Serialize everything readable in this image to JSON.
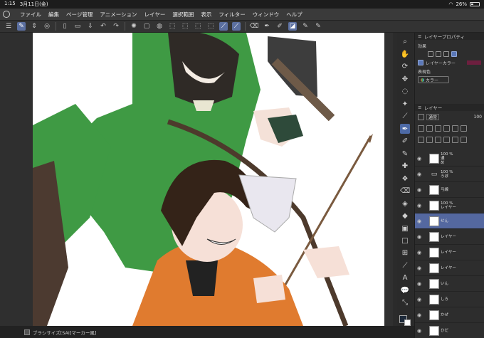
{
  "status_bar": {
    "time": "1:15",
    "date": "3月11日(金)",
    "battery": "26%",
    "battery_level": 0.26
  },
  "menu": {
    "items": [
      "ファイル",
      "編集",
      "ページ管理",
      "アニメーション",
      "レイヤー",
      "選択範囲",
      "表示",
      "フィルター",
      "ウィンドウ",
      "ヘルプ"
    ]
  },
  "property_panel": {
    "title": "レイヤープロパティ",
    "effect_label": "効果",
    "layer_color_label": "レイヤーカラー",
    "layer_color": "#6d1f3f",
    "expression_color_label": "表現色",
    "expression_color_value": "カラー"
  },
  "layer_panel": {
    "title": "レイヤー",
    "blend_mode": "通常",
    "opacity": "100",
    "layers": [
      {
        "opacity": "100 %",
        "name": "め",
        "prefix": "通",
        "type": "raster",
        "selected": false
      },
      {
        "opacity": "100 %",
        "name": "ろぽ",
        "prefix": "",
        "type": "folder",
        "selected": false
      },
      {
        "opacity": "",
        "name": "弓線",
        "prefix": "",
        "type": "raster",
        "selected": false
      },
      {
        "opacity": "100 %",
        "name": "レイヤー",
        "prefix": "",
        "type": "raster",
        "selected": false
      },
      {
        "opacity": "",
        "name": "せん",
        "prefix": "",
        "type": "raster",
        "selected": true
      },
      {
        "opacity": "",
        "name": "レイヤー",
        "prefix": "",
        "type": "raster",
        "selected": false
      },
      {
        "opacity": "",
        "name": "レイヤー",
        "prefix": "",
        "type": "raster",
        "selected": false
      },
      {
        "opacity": "",
        "name": "レイヤー",
        "prefix": "",
        "type": "raster",
        "selected": false
      },
      {
        "opacity": "",
        "name": "いん",
        "prefix": "",
        "type": "raster",
        "selected": false
      },
      {
        "opacity": "",
        "name": "しろ",
        "prefix": "",
        "type": "raster",
        "selected": false
      },
      {
        "opacity": "",
        "name": "かぜ",
        "prefix": "",
        "type": "raster",
        "selected": false
      },
      {
        "opacity": "",
        "name": "ひだ",
        "prefix": "",
        "type": "raster",
        "selected": false
      }
    ]
  },
  "bottom_bar": {
    "brush_size_label": "ブラシサイズ[SAI]マーカー風]"
  },
  "colors": {
    "main_color": "#1e2a3a",
    "sub_color": "#ffffff",
    "accent": "#5468a0"
  }
}
